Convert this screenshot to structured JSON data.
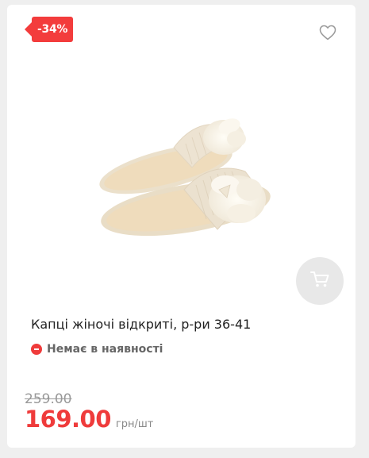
{
  "product": {
    "discount_badge": "-34%",
    "title": "Капці жіночі відкриті, р-ри 36-41",
    "stock_status": "Немає в наявності",
    "old_price": "259.00",
    "price": "169.00",
    "unit": "грн/шт"
  },
  "icons": {
    "wishlist": "heart-icon",
    "cart": "cart-icon",
    "stock": "minus-circle-icon"
  },
  "colors": {
    "accent": "#ef3b3b",
    "muted": "#999999",
    "card": "#ffffff",
    "background": "#efefef"
  }
}
